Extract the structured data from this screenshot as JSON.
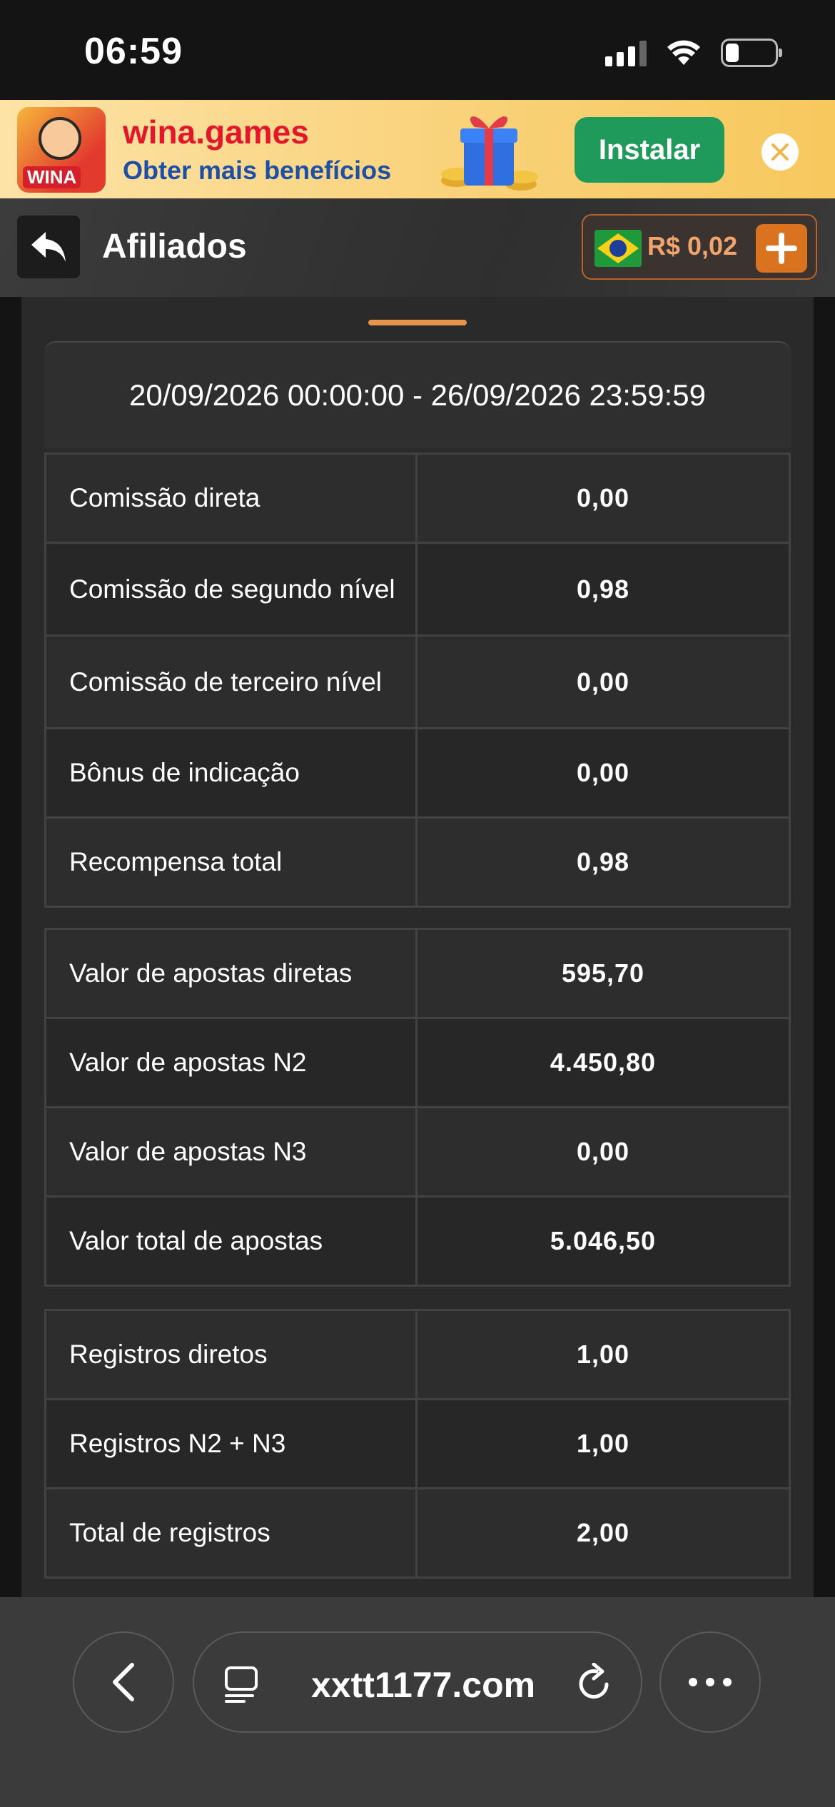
{
  "status_bar": {
    "time": "06:59"
  },
  "banner": {
    "title": "wina.games",
    "subtitle": "Obter mais benefícios",
    "logo_text": "WINA",
    "install_label": "Instalar"
  },
  "header": {
    "title": "Afiliados",
    "balance": "R$ 0,02"
  },
  "date_range": "20/09/2026 00:00:00 - 26/09/2026 23:59:59",
  "commissions": [
    {
      "label": "Comissão direta",
      "value": "0,00"
    },
    {
      "label": "Comissão de segundo nível",
      "value": "0,98"
    },
    {
      "label": "Comissão de terceiro nível",
      "value": "0,00"
    },
    {
      "label": "Bônus de indicação",
      "value": "0,00"
    },
    {
      "label": "Recompensa total",
      "value": "0,98"
    }
  ],
  "bets": [
    {
      "label": "Valor de apostas diretas",
      "value": "595,70"
    },
    {
      "label": "Valor de apostas N2",
      "value": "4.450,80"
    },
    {
      "label": "Valor de apostas N3",
      "value": "0,00"
    },
    {
      "label": "Valor total de apostas",
      "value": "5.046,50"
    }
  ],
  "registrations": [
    {
      "label": "Registros diretos",
      "value": "1,00"
    },
    {
      "label": "Registros N2 + N3",
      "value": "1,00"
    },
    {
      "label": "Total de registros",
      "value": "2,00"
    }
  ],
  "browser": {
    "url": "xxtt1177.com"
  },
  "colors": {
    "accent": "#e8944a",
    "install": "#1f9a5a",
    "balance": "#f1a46b",
    "plus": "#d9731f"
  }
}
